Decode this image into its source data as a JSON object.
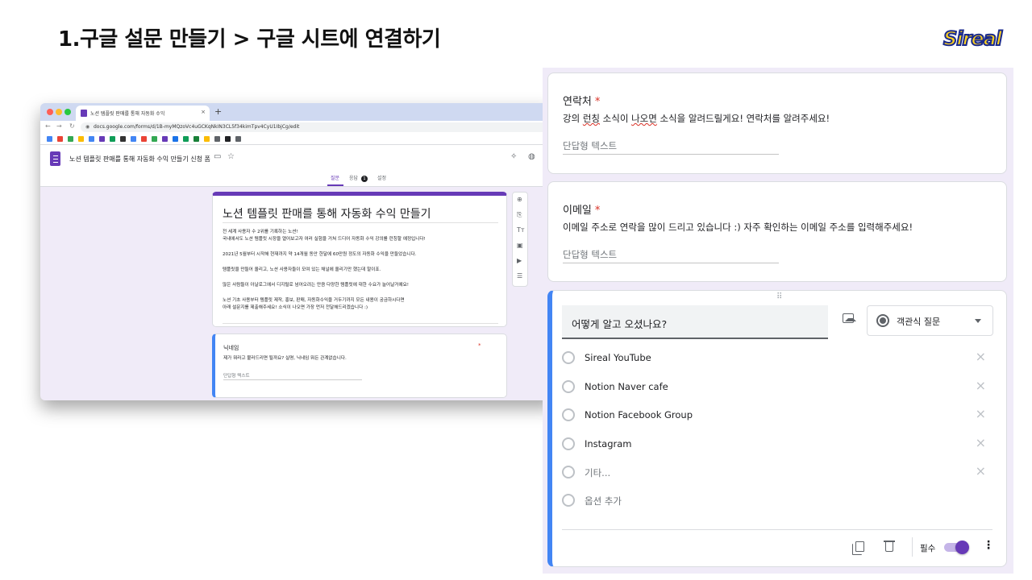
{
  "slide": {
    "title": "1.구글 설문 만들기 > 구글 시트에 연결하기",
    "logo": "Sireal"
  },
  "browser": {
    "tab_title": "노션 템플릿 판매를 통해 자동화 수익",
    "tab_close": "×",
    "new_tab": "+",
    "url": "docs.google.com/forms/d/1B-myMQzoVc4uGCKqNkIN3CL5f34kimTpv4CyU1IbjCg/edit",
    "nav": {
      "back": "←",
      "forward": "→",
      "reload": "↻",
      "lock": "🔒"
    },
    "form_name": "노션 템플릿 판매를 통해 자동화 수익 만들기 신청 폼",
    "header_icons": {
      "folder": "▭",
      "star": "☆",
      "addon": "✧",
      "palette": "◍"
    },
    "form_tabs": {
      "questions": "질문",
      "responses": "응답",
      "responses_count": "1",
      "settings": "설정"
    },
    "title_card": {
      "title": "노션 템플릿 판매를 통해 자동화 수익 만들기",
      "desc1": "전 세계 사용자 수 2위를 기록하는 노션!",
      "desc2": "국내에서도 노션 템플릿 시장을 열어보고자 여러 실험을 거쳐 드디어 자동화 수익 강의를 런칭할 예정입니다!",
      "desc3": "2021년 5월부터 시작해 현재까지 약 14개월 동안 한달에 60만원 정도의 자동화 수익을 만들었습니다.",
      "desc4": "템플릿을 만들어 올리고, 노션 사용자들이 모여 있는 채널에 올리기만 했는데 말이죠.",
      "desc5": "많은 사람들이 아날로그에서 디지털로 넘어오려는 만큼 다양한 템플릿에 대한 수요가 늘어날거예요!",
      "desc6": "노션 기초 사용부터 템플릿 제작, 홍보, 판매, 자동화수익을 거두기까지 모든 내용이 궁금하시다면",
      "desc7": "아래 설문지를 제출해주세요! 소식이 나오면 가장 먼저 전달해드리겠습니다 :)"
    },
    "side_toolbar": {
      "add": "⊕",
      "import": "⎘",
      "text": "Tт",
      "image": "▣",
      "video": "▶",
      "section": "☰"
    },
    "nickname_card": {
      "question": "닉네임",
      "star": "*",
      "desc": "제가 뭐라고 불러드리면 될까요? 실명, 닉네임 뭐든 관계없습니다.",
      "placeholder": "단답형 텍스트"
    }
  },
  "panel": {
    "contact": {
      "question": "연락처",
      "star": "*",
      "desc_a": "강의 ",
      "desc_b": "런칭",
      "desc_c": " 소식이 ",
      "desc_d": "나오면",
      "desc_e": " 소식을 알려드릴게요! 연락처를 알려주세요!",
      "placeholder": "단답형 텍스트"
    },
    "email": {
      "question": "이메일",
      "star": "*",
      "desc": "이메일 주소로 연락을 많이 드리고 있습니다 :) 자주 확인하는 이메일 주소를 입력해주세요!",
      "placeholder": "단답형 텍스트"
    },
    "choice": {
      "drag_handle": "⠿",
      "question": "어떻게 알고 오셨나요?",
      "type": "객관식 질문",
      "options": [
        "Sireal YouTube",
        "Notion Naver cafe",
        "Notion Facebook Group",
        "Instagram",
        "기타..."
      ],
      "add_option": "옵션 추가",
      "remove": "×",
      "required_label": "필수",
      "required_on": true,
      "more": "⋮"
    }
  },
  "colors": {
    "accent": "#673ab7",
    "active_border": "#4285f4",
    "required": "#d93025",
    "background": "#f0ebf8"
  }
}
